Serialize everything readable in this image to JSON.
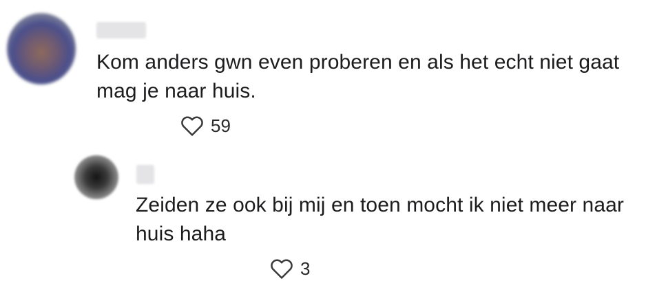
{
  "comments": [
    {
      "text": "Kom anders gwn even proberen en als het echt niet gaat mag je naar huis.",
      "likes": "59",
      "like_icon": "heart-outline-icon"
    }
  ],
  "replies": [
    {
      "text": "Zeiden ze ook bij mij en toen mocht ik niet meer naar huis haha",
      "likes": "3",
      "like_icon": "heart-outline-icon"
    }
  ]
}
